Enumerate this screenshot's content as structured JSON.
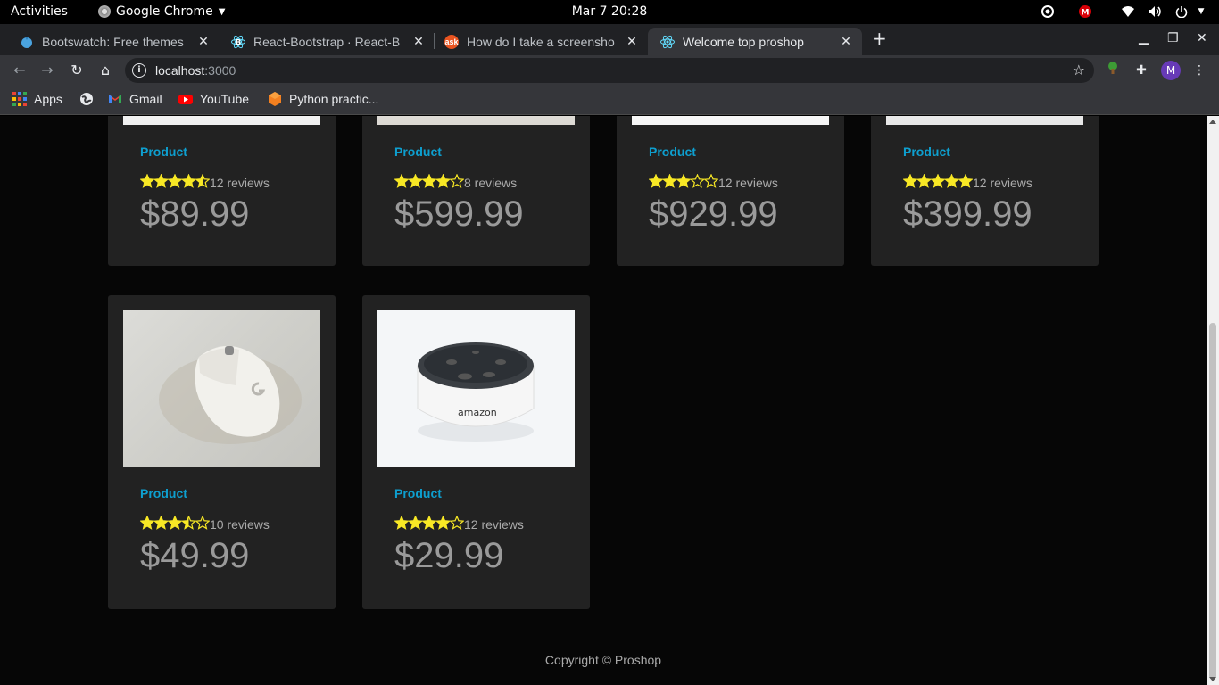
{
  "system_bar": {
    "activities": "Activities",
    "app_name": "Google Chrome",
    "clock": "Mar 7  20:28"
  },
  "tabs": [
    {
      "title": "Bootswatch: Free themes",
      "favicon": "bootswatch-icon",
      "active": false
    },
    {
      "title": "React-Bootstrap · React-B",
      "favicon": "react-bootstrap-icon",
      "active": false
    },
    {
      "title": "How do I take a screensho",
      "favicon": "askubuntu-icon",
      "active": false
    },
    {
      "title": "Welcome top proshop",
      "favicon": "react-icon",
      "active": true
    }
  ],
  "omnibox": {
    "host": "localhost",
    "port": ":3000"
  },
  "profile_initial": "M",
  "bookmarks": [
    {
      "label": "Apps",
      "icon": "apps-grid-icon"
    },
    {
      "label": "",
      "icon": "globe-icon"
    },
    {
      "label": "Gmail",
      "icon": "gmail-icon"
    },
    {
      "label": "YouTube",
      "icon": "youtube-icon"
    },
    {
      "label": "Python practic...",
      "icon": "python-practice-icon"
    }
  ],
  "products": [
    {
      "name": "Product",
      "rating": 4.5,
      "reviews_text": "12 reviews",
      "price": "$89.99"
    },
    {
      "name": "Product",
      "rating": 4,
      "reviews_text": "8 reviews",
      "price": "$599.99"
    },
    {
      "name": "Product",
      "rating": 3,
      "reviews_text": "12 reviews",
      "price": "$929.99"
    },
    {
      "name": "Product",
      "rating": 5,
      "reviews_text": "12 reviews",
      "price": "$399.99"
    },
    {
      "name": "Product",
      "rating": 3.5,
      "reviews_text": "10 reviews",
      "price": "$49.99"
    },
    {
      "name": "Product",
      "rating": 4,
      "reviews_text": "12 reviews",
      "price": "$29.99"
    }
  ],
  "echo_brand": "amazon",
  "footer": "Copyright © Proshop",
  "colors": {
    "link": "#0e9fcf",
    "star": "#f8e825",
    "card": "#222222",
    "page_bg": "#060606"
  }
}
